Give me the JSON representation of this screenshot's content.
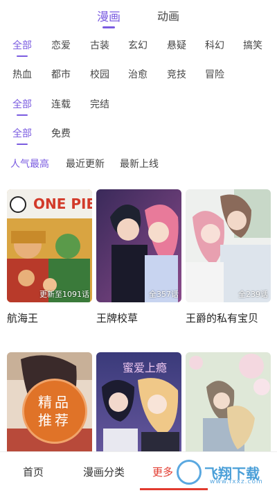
{
  "top_tabs": [
    {
      "label": "漫画",
      "active": true
    },
    {
      "label": "动画",
      "active": false
    }
  ],
  "filters": {
    "genre_row1": [
      "全部",
      "恋爱",
      "古装",
      "玄幻",
      "悬疑",
      "科幻",
      "搞笑"
    ],
    "genre_row2": [
      "热血",
      "都市",
      "校园",
      "治愈",
      "竞技",
      "冒险"
    ],
    "status": [
      "全部",
      "连载",
      "完结"
    ],
    "price": [
      "全部",
      "免费"
    ]
  },
  "sort": [
    "人气最高",
    "最近更新",
    "最新上线"
  ],
  "comics": [
    {
      "title": "航海王",
      "episode": "更新至1091话"
    },
    {
      "title": "王牌校草",
      "episode": "全357话"
    },
    {
      "title": "王爵的私有宝贝",
      "episode": "全239话"
    },
    {
      "title": "",
      "badge": [
        "精品",
        "推荐"
      ]
    },
    {
      "title": "",
      "cover_text": "蜜爱上瘾"
    },
    {
      "title": ""
    }
  ],
  "bottom_nav": [
    {
      "label": "首页"
    },
    {
      "label": "漫画分类"
    },
    {
      "label": "更多"
    }
  ],
  "watermark": {
    "text": "飞翔下载",
    "url": "www.fxxz.com"
  },
  "colors": {
    "accent": "#7a5be0",
    "nav_active": "#e23a2e"
  }
}
